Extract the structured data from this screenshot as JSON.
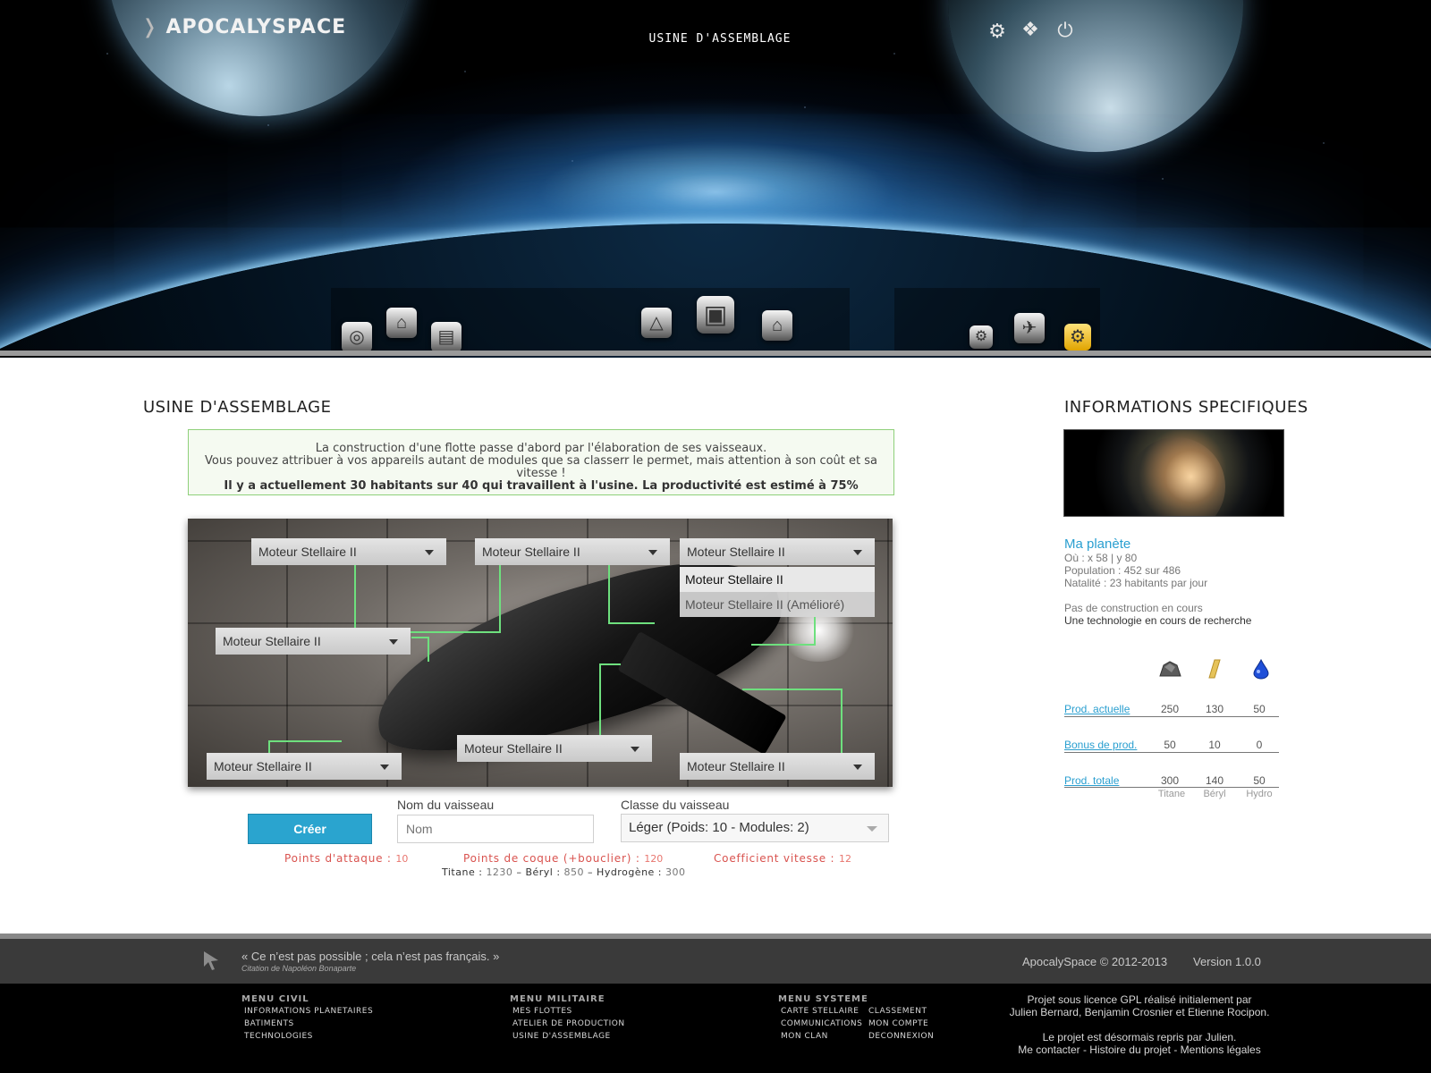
{
  "header": {
    "brand": "APOCALYSPACE",
    "page_title": "USINE D'ASSEMBLAGE",
    "top_icons": [
      "gears-icon",
      "gift-icon",
      "power-icon"
    ],
    "nav_icons": [
      "globe-icon",
      "satellite-icon",
      "factory-icon",
      "flask-icon",
      "cube-icon",
      "house-icon",
      "gear-icon",
      "spaceship-icon",
      "settings-icon"
    ]
  },
  "main": {
    "title": "USINE D'ASSEMBLAGE",
    "intro": {
      "line1": "La construction d'une flotte passe d'abord par l'élaboration de ses vaisseaux.",
      "line2": "Vous pouvez attribuer à vos appareils autant de modules que sa classerr le permet, mais attention à son coût et sa vitesse !",
      "line3": "Il y a actuellement 30 habitants sur 40 qui travaillent à l'usine. La productivité est estimé à 75%"
    },
    "modules": [
      "Moteur Stellaire II",
      "Moteur Stellaire II",
      "Moteur Stellaire II",
      "Moteur Stellaire II",
      "Moteur Stellaire II",
      "Moteur Stellaire II",
      "Moteur Stellaire II"
    ],
    "dropdown_options": [
      "Moteur Stellaire II",
      "Moteur Stellaire II (Amélioré)"
    ],
    "create_label": "Créer",
    "name_label": "Nom du vaisseau",
    "name_placeholder": "Nom",
    "class_label": "Classe du vaisseau",
    "class_value": "Léger (Poids: 10 - Modules: 2)",
    "stats": {
      "attack_label": "Points d'attaque :",
      "attack_value": "10",
      "hull_label": "Points de coque (+bouclier) :",
      "hull_value": "120",
      "speed_label": "Coefficient vitesse :",
      "speed_value": "12"
    },
    "cost": {
      "titane_label": "Titane :",
      "titane_value": "1230",
      "sep1": "–",
      "beryl_label": "Béryl :",
      "beryl_value": "850",
      "sep2": "–",
      "hydro_label": "Hydrogène :",
      "hydro_value": "300"
    }
  },
  "sidebar": {
    "title": "INFORMATIONS SPECIFIQUES",
    "planet_name": "Ma planète",
    "location": "Où : x 58 | y 80",
    "population": "Population : 452 sur 486",
    "natality": "Natalité : 23 habitants par jour",
    "construction": "Pas de construction en cours",
    "research": "Une technologie en cours de recherche",
    "resource_icons": [
      "titane-ore-icon",
      "beryl-ingot-icon",
      "hydro-drop-icon"
    ],
    "rows": [
      {
        "label": "Prod. actuelle",
        "values": [
          "250",
          "130",
          "50"
        ]
      },
      {
        "label": "Bonus de prod.",
        "values": [
          "50",
          "10",
          "0"
        ]
      },
      {
        "label": "Prod. totale",
        "values": [
          "300",
          "140",
          "50"
        ]
      }
    ],
    "resource_names": [
      "Titane",
      "Béryl",
      "Hydro"
    ]
  },
  "footer": {
    "quote": "« Ce n’est pas possible ; cela n’est pas français. »",
    "quote_source": "Citation de Napoléon Bonaparte",
    "copyright": "ApocalySpace © 2012-2013",
    "version": "Version 1.0.0",
    "menu_civil": {
      "title": "MENU CIVIL",
      "items": [
        "INFORMATIONS PLANETAIRES",
        "BATIMENTS",
        "TECHNOLOGIES"
      ]
    },
    "menu_militaire": {
      "title": "MENU MILITAIRE",
      "items": [
        "MES FLOTTES",
        "ATELIER DE PRODUCTION",
        "USINE D'ASSEMBLAGE"
      ]
    },
    "menu_systeme": {
      "title": "MENU SYSTEME",
      "items": [
        "CARTE STELLAIRE",
        "CLASSEMENT",
        "COMMUNICATIONS",
        "MON COMPTE",
        "MON CLAN",
        "DECONNEXION"
      ]
    },
    "credits": {
      "line1": "Projet sous licence GPL réalisé initialement par",
      "line2": "Julien Bernard, Benjamin Crosnier et Etienne Rocipon.",
      "line3": "Le projet est désormais repris par Julien.",
      "line4": "Me contacter - Histoire du projet - Mentions légales"
    }
  }
}
